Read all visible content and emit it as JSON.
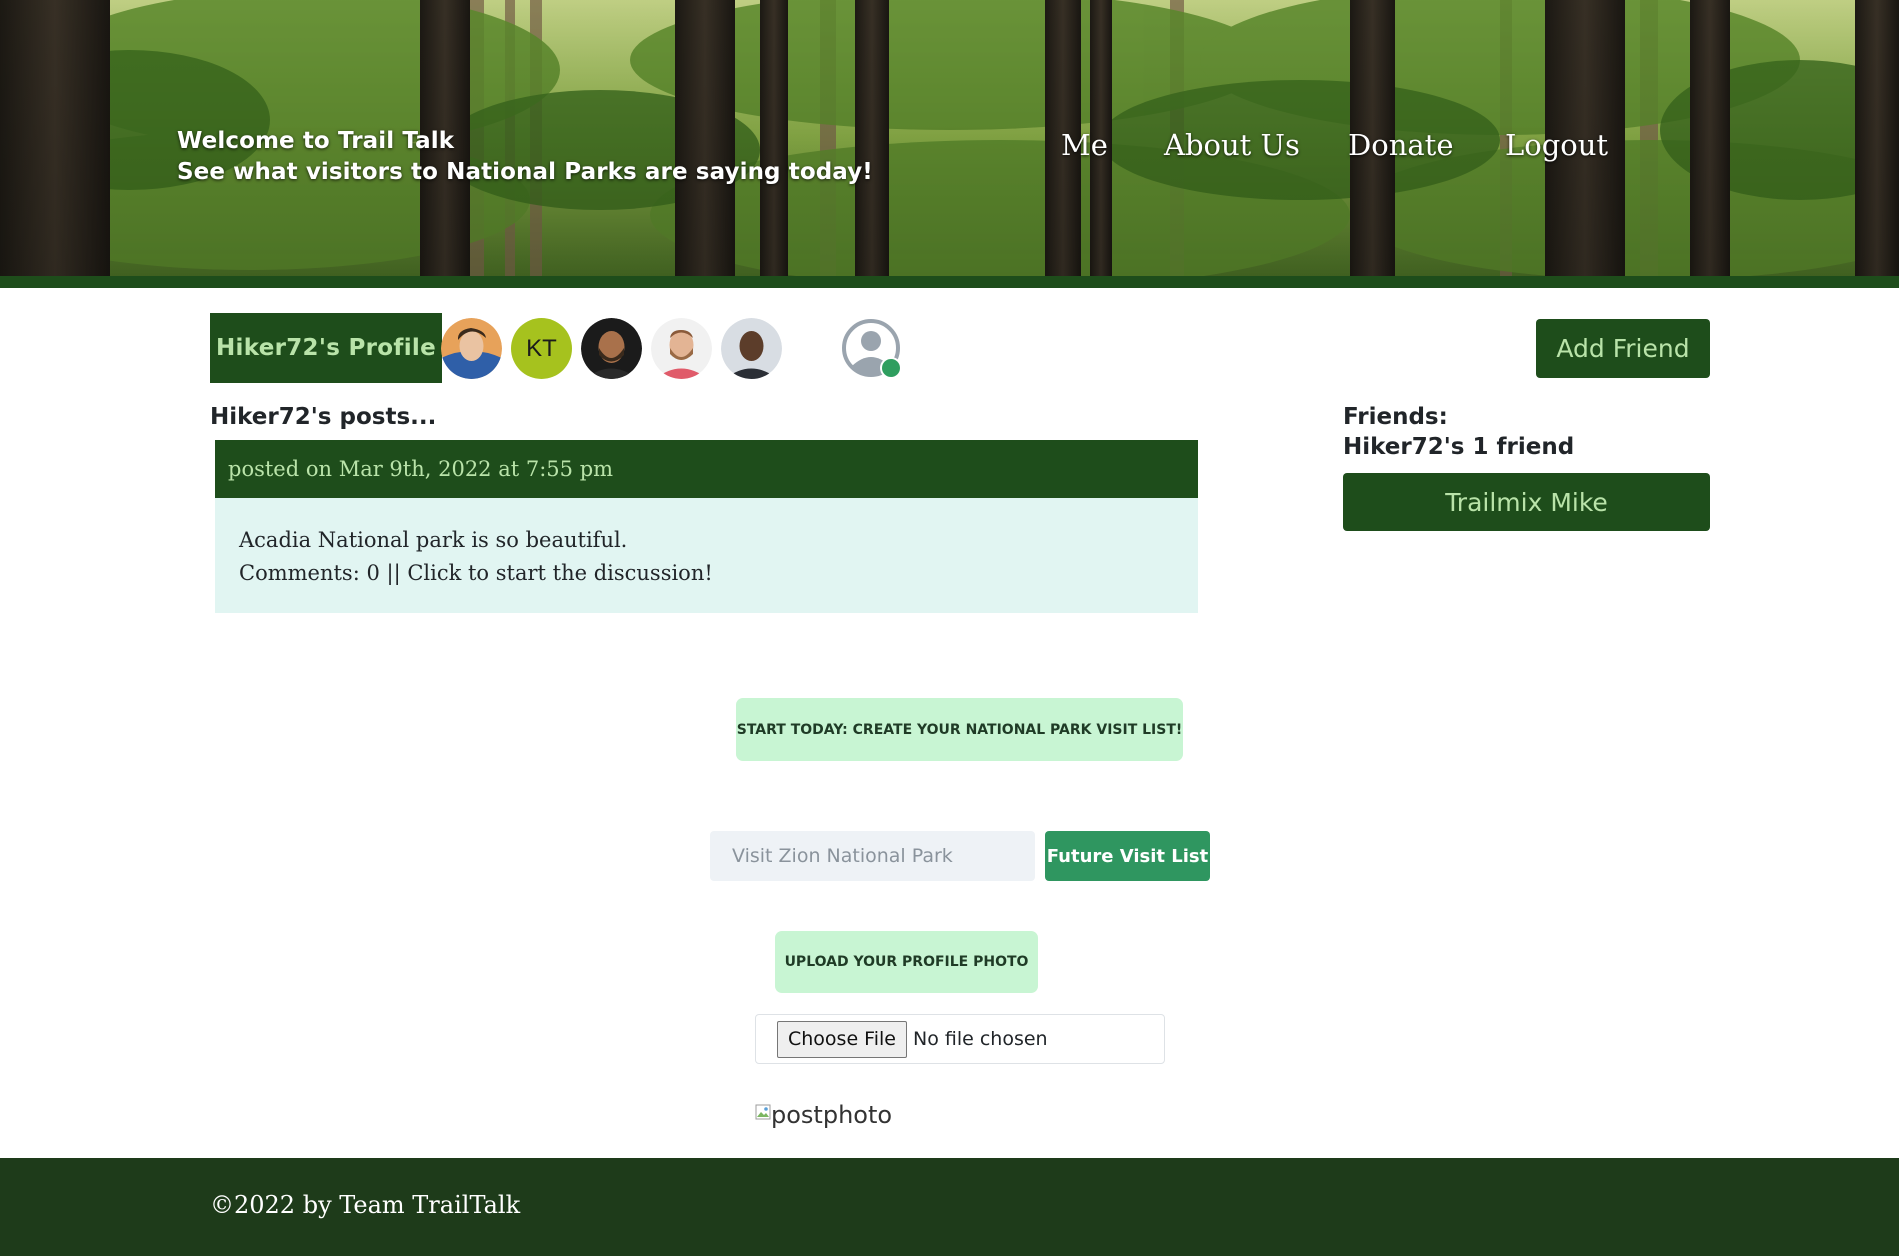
{
  "header": {
    "welcome_line1": "Welcome to Trail Talk",
    "welcome_line2": "See what visitors to National Parks are saying today!",
    "nav": {
      "me": "Me",
      "about": "About Us",
      "donate": "Donate",
      "logout": "Logout"
    }
  },
  "profile": {
    "title": "Hiker72's Profile",
    "avatar_initials": "KT",
    "add_friend_label": "Add Friend"
  },
  "posts": {
    "heading": "Hiker72's posts...",
    "items": [
      {
        "meta": "posted on Mar 9th, 2022 at 7:55 pm",
        "text": "Acadia National park is so beautiful.",
        "comments": "Comments: 0 || Click to start the discussion!"
      }
    ]
  },
  "friends": {
    "label": "Friends:",
    "count_text": "Hiker72's 1 friend",
    "list": [
      "Trailmix Mike"
    ]
  },
  "visit_list": {
    "badge": "START TODAY: CREATE YOUR NATIONAL PARK VISIT LIST!",
    "input_placeholder": "Visit Zion National Park",
    "button_label": "Future Visit List"
  },
  "upload": {
    "badge": "UPLOAD YOUR PROFILE PHOTO",
    "choose_label": "Choose File",
    "status": "No file chosen",
    "image_alt": "postphoto"
  },
  "footer": {
    "text": "©2022 by Team TrailTalk"
  },
  "colors": {
    "brand_green": "#1e4d1b",
    "light_green_text": "#b9e3a9",
    "accent_button": "#2f9660",
    "badge_bg": "#c8f5d3",
    "post_body_bg": "#e1f5f2",
    "footer_bg": "#1e3b1a",
    "online_status": "#2f9e5f"
  },
  "icons": {
    "status_avatar": "user-circle-icon",
    "online_dot": "online-status-icon",
    "broken_image": "broken-image-icon"
  }
}
